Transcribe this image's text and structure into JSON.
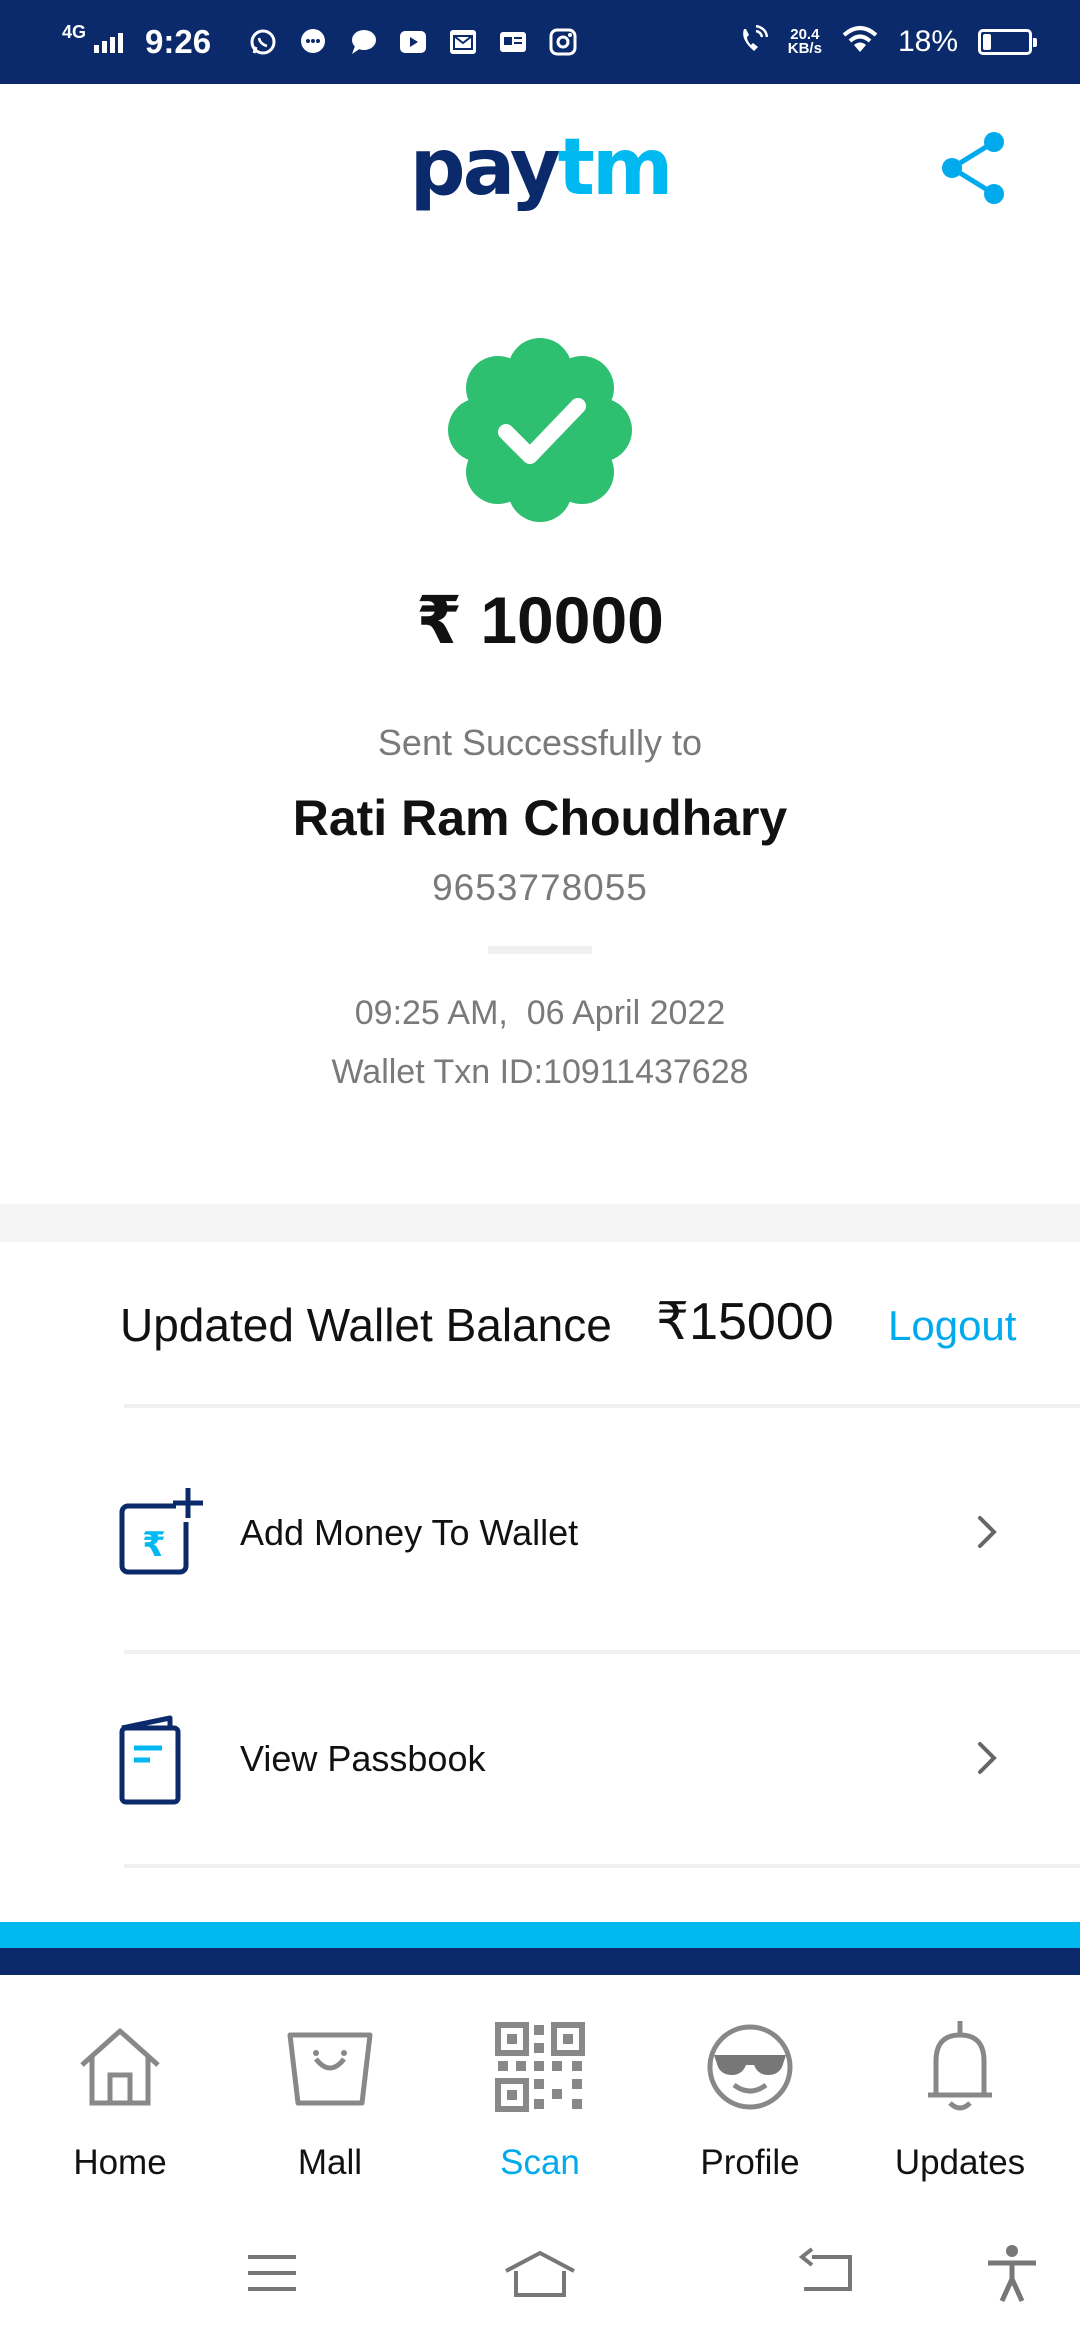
{
  "status_bar": {
    "network": "4G",
    "time": "9:26",
    "net_speed_value": "20.4",
    "net_speed_unit": "KB/s",
    "battery_percent_label": "18%",
    "battery_level": 0.18,
    "notification_icons": [
      "whatsapp-icon",
      "message-icon",
      "chat-icon",
      "youtube-icon",
      "mail-icon",
      "news-icon",
      "instagram-icon"
    ]
  },
  "header": {
    "logo_part1": "pay",
    "logo_part2": "tm",
    "share_icon": "share-icon"
  },
  "receipt": {
    "status_icon": "verified-check-badge-icon",
    "amount": "₹ 10000",
    "sent_label": "Sent Successfully to",
    "recipient_name": "Rati Ram Choudhary",
    "recipient_phone": "9653778055",
    "datetime": "09:25 AM,  06 April 2022",
    "txn_id": "Wallet Txn ID:10911437628"
  },
  "wallet": {
    "balance_label": "Updated Wallet Balance",
    "balance_amount": "₹15000",
    "logout_label": "Logout"
  },
  "actions": [
    {
      "label": "Add Money To Wallet",
      "icon": "add-money-wallet-icon"
    },
    {
      "label": "View Passbook",
      "icon": "passbook-icon"
    }
  ],
  "bottom_nav": [
    {
      "label": "Home",
      "icon": "home-icon",
      "active": false
    },
    {
      "label": "Mall",
      "icon": "mall-bag-icon",
      "active": false
    },
    {
      "label": "Scan",
      "icon": "qr-scan-icon",
      "active": true
    },
    {
      "label": "Profile",
      "icon": "profile-sunglasses-icon",
      "active": false
    },
    {
      "label": "Updates",
      "icon": "bell-icon",
      "active": false
    }
  ],
  "colors": {
    "brand_dark": "#0b2a6b",
    "brand_light": "#00b9f1",
    "success": "#2fbf71",
    "link": "#00aaec"
  }
}
